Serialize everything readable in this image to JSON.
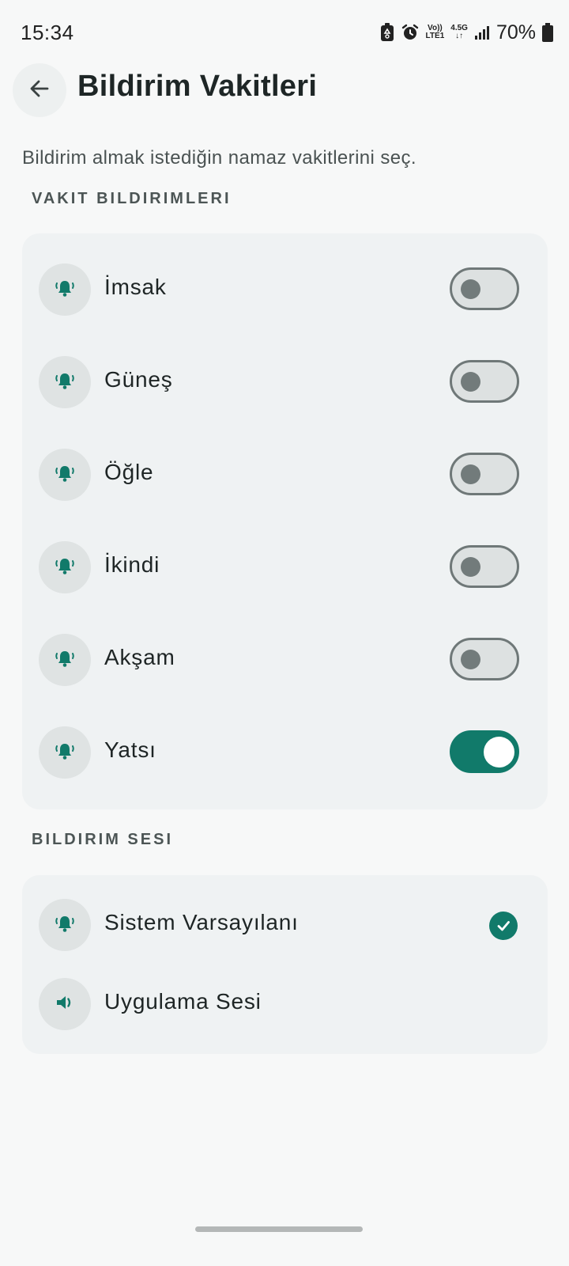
{
  "status_bar": {
    "time": "15:34",
    "network_top": "Vo))",
    "network_bottom": "LTE1",
    "data_type": "4.5G",
    "battery": "70%"
  },
  "header": {
    "back_icon": "arrow-left-icon",
    "title": "Bildirim Vakitleri"
  },
  "subtitle": "Bildirim almak istediğin namaz vakitlerini seç.",
  "prayer_section": {
    "title": "VAKIT BILDIRIMLERI",
    "items": [
      {
        "label": "İmsak",
        "icon": "bell-ring-icon",
        "enabled": false
      },
      {
        "label": "Güneş",
        "icon": "bell-ring-icon",
        "enabled": false
      },
      {
        "label": "Öğle",
        "icon": "bell-ring-icon",
        "enabled": false
      },
      {
        "label": "İkindi",
        "icon": "bell-ring-icon",
        "enabled": false
      },
      {
        "label": "Akşam",
        "icon": "bell-ring-icon",
        "enabled": false
      },
      {
        "label": "Yatsı",
        "icon": "bell-ring-icon",
        "enabled": true
      }
    ]
  },
  "sound_section": {
    "title": "BILDIRIM SESI",
    "items": [
      {
        "label": "Sistem Varsayılanı",
        "icon": "bell-ring-icon",
        "selected": true
      },
      {
        "label": "Uygulama Sesi",
        "icon": "speaker-icon",
        "selected": false
      }
    ]
  },
  "colors": {
    "accent": "#117a6a",
    "card_background": "#eff2f3",
    "page_background": "#f7f8f8"
  }
}
